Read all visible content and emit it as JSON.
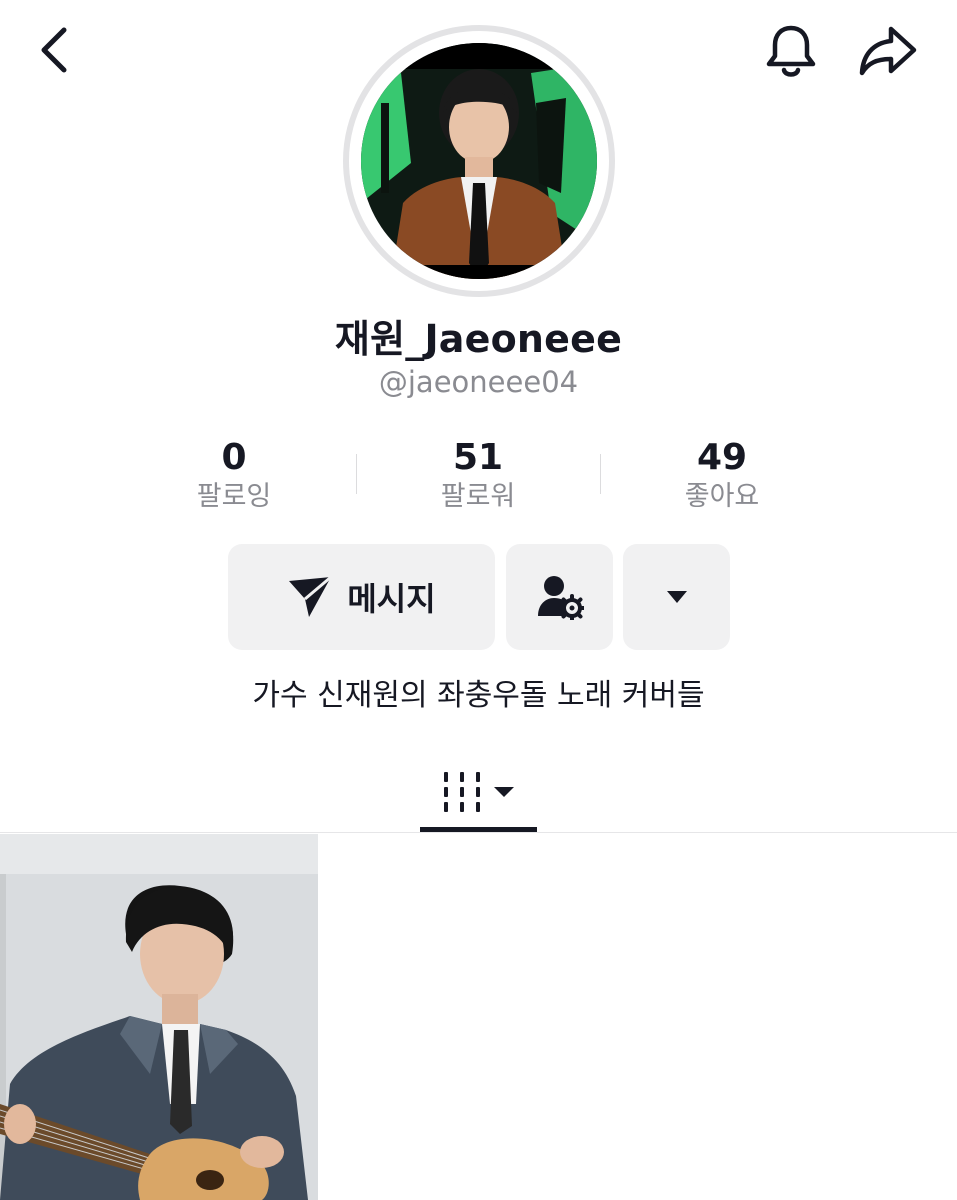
{
  "header": {
    "back_icon": "chevron-left-icon",
    "bell_icon": "bell-icon",
    "share_icon": "share-arrow-icon"
  },
  "profile": {
    "display_name": "재원_Jaeoneee",
    "username": "@jaeoneee04",
    "bio": "가수 신재원의 좌충우돌 노래 커버들"
  },
  "stats": [
    {
      "value": "0",
      "label": "팔로잉"
    },
    {
      "value": "51",
      "label": "팔로워"
    },
    {
      "value": "49",
      "label": "좋아요"
    }
  ],
  "actions": {
    "message_label": "메시지",
    "message_icon": "send-icon",
    "follow_settings_icon": "user-gear-icon",
    "more_icon": "caret-down-icon"
  },
  "tabs": {
    "active_icon": "videos-grid-icon"
  },
  "colors": {
    "text": "#161823",
    "secondary": "#8a8b91",
    "button_bg": "#f1f1f2",
    "avatar_ring": "#e3e3e5"
  }
}
